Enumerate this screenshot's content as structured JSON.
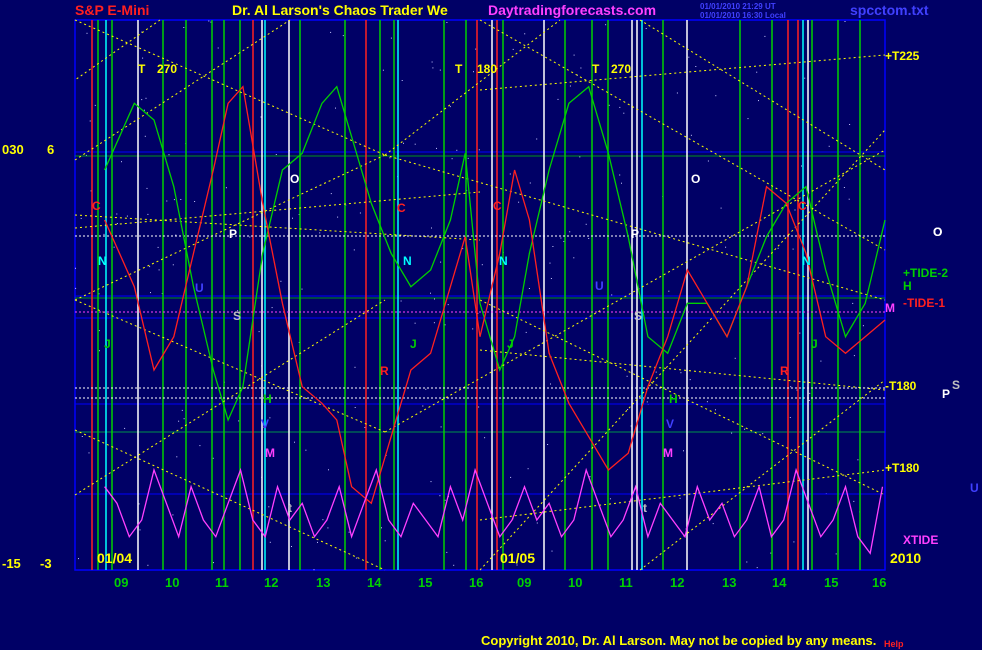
{
  "colors": {
    "background": "#000066",
    "grid_blue": "#0000ff",
    "green": "#00d000",
    "red": "#ff2020",
    "magenta": "#ff40ff",
    "yellow": "#ffff00",
    "white": "#ffffff",
    "cyan": "#00ffff",
    "copyright": "#ffff00"
  },
  "header": {
    "instrument": "S&P E-Mini",
    "title": "Dr. Al Larson's Chaos Trader We",
    "site": "Daytradingforecasts.com",
    "stamp_1": "01/01/2010 21:29 UT",
    "stamp_2": "01/01/2010 16:30 Local",
    "file": "spcctom.txt"
  },
  "footer": {
    "copyright": "Copyright 2010, Dr. Al Larson. May not be copied by any means.",
    "corner_note": "Help"
  },
  "left_scale": {
    "top_a": "030",
    "top_b": "6",
    "bottom_a": "-15",
    "bottom_b": "-3"
  },
  "chart_data": {
    "type": "line",
    "dates": [
      "01/04",
      "01/05",
      "2010"
    ],
    "x_ticks": [
      "09",
      "10",
      "11",
      "12",
      "13",
      "14",
      "15",
      "16",
      "09",
      "10",
      "11",
      "12",
      "13",
      "14",
      "15",
      "16"
    ],
    "series": [
      {
        "name": "",
        "color": "green",
        "x": [
          0,
          0.3,
          0.6,
          1.0,
          1.4,
          1.8,
          2.2,
          2.5,
          2.8,
          3.2,
          3.6,
          4.0,
          4.4,
          4.7,
          5.0,
          5.4,
          5.8,
          6.2,
          6.6,
          7.0,
          7.3,
          7.6,
          8.0,
          8.3,
          8.6,
          9.0,
          9.4,
          9.8,
          10.2,
          10.6,
          11.0,
          11.4,
          11.8,
          12.2,
          12.6,
          13.0,
          13.4,
          13.8,
          14.2,
          14.6,
          15.0,
          15.4,
          15.8
        ],
        "y": [
          9,
          11,
          13,
          12,
          8,
          2,
          -3,
          -6,
          -4,
          4,
          9,
          10,
          13,
          14,
          11,
          7,
          4,
          2,
          3,
          6,
          10,
          1,
          -3,
          -1,
          4,
          9,
          13,
          14,
          10,
          5,
          -1,
          -2,
          1,
          1,
          -1,
          2,
          5,
          7,
          8,
          3,
          -1,
          1,
          6
        ]
      },
      {
        "name": "",
        "color": "red",
        "x": [
          0,
          0.3,
          0.6,
          1.0,
          1.4,
          1.8,
          2.2,
          2.5,
          2.8,
          3.2,
          3.6,
          4.0,
          4.4,
          4.7,
          5.0,
          5.4,
          5.8,
          6.2,
          6.6,
          7.0,
          7.3,
          7.6,
          8.0,
          8.3,
          8.6,
          9.0,
          9.4,
          9.8,
          10.2,
          10.6,
          11.0,
          11.4,
          11.8,
          12.2,
          12.6,
          13.0,
          13.4,
          13.8,
          14.2,
          14.6,
          15.0,
          15.4,
          15.8
        ],
        "y": [
          6,
          4,
          2,
          -3,
          -1,
          4,
          9,
          13,
          14,
          7,
          1,
          -4,
          -5,
          -6,
          -10,
          -11,
          -7,
          -3,
          -2,
          2,
          5,
          -1,
          4,
          9,
          6,
          -2,
          -5,
          -7,
          -9,
          -8,
          -4,
          -1,
          3,
          1,
          -1,
          2,
          8,
          7,
          4,
          -1,
          -2,
          -1,
          0
        ]
      },
      {
        "name": "XTIDE",
        "color": "magenta",
        "x": [
          0,
          0.25,
          0.5,
          0.75,
          1.0,
          1.25,
          1.5,
          1.75,
          2.0,
          2.25,
          2.5,
          2.75,
          3.0,
          3.25,
          3.5,
          3.75,
          4.0,
          4.25,
          4.5,
          4.75,
          5.0,
          5.25,
          5.5,
          5.75,
          6.0,
          6.25,
          6.5,
          6.75,
          7.0,
          7.25,
          7.5,
          7.75,
          8.0,
          8.25,
          8.5,
          8.75,
          9.0,
          9.25,
          9.5,
          9.75,
          10.0,
          10.25,
          10.5,
          10.75,
          11.0,
          11.25,
          11.5,
          11.75,
          12.0,
          12.25,
          12.5,
          12.75,
          13.0,
          13.25,
          13.5,
          13.75,
          14.0,
          14.25,
          14.5,
          14.75,
          15.0,
          15.25,
          15.5,
          15.75
        ],
        "y": [
          -10,
          -11,
          -13,
          -12,
          -9,
          -11,
          -13,
          -10,
          -12,
          -13,
          -11,
          -9,
          -12,
          -13,
          -10,
          -12,
          -11,
          -13,
          -12,
          -10,
          -13,
          -11,
          -9,
          -12,
          -13,
          -11,
          -12,
          -13,
          -10,
          -12,
          -9,
          -11,
          -13,
          -12,
          -10,
          -12,
          -11,
          -13,
          -12,
          -9,
          -11,
          -13,
          -12,
          -10,
          -13,
          -11,
          -12,
          -13,
          -10,
          -12,
          -11,
          -13,
          -12,
          -10,
          -13,
          -12,
          -9,
          -11,
          -13,
          -12,
          -10,
          -13,
          -14,
          -10
        ]
      }
    ],
    "ylim": [
      -15,
      18
    ],
    "xlim": [
      -0.6,
      15.8
    ],
    "right_labels": [
      {
        "text": "+T225",
        "color": "yellow"
      },
      {
        "text": "+TIDE-2",
        "color": "green"
      },
      {
        "text": "H",
        "color": "green"
      },
      {
        "text": "-TIDE-1",
        "color": "red"
      },
      {
        "text": "M",
        "color": "magenta"
      },
      {
        "text": "-T180",
        "color": "yellow"
      },
      {
        "text": "+T180",
        "color": "yellow"
      },
      {
        "text": "XTIDE",
        "color": "magenta"
      },
      {
        "text": "O",
        "color": "white"
      },
      {
        "text": "P",
        "color": "white"
      },
      {
        "text": "S",
        "color": "silver"
      },
      {
        "text": "U",
        "color": "blue"
      }
    ],
    "annotations": [
      {
        "text": "T",
        "color": "yellow"
      },
      {
        "text": "270",
        "color": "yellow"
      },
      {
        "text": "T",
        "color": "yellow"
      },
      {
        "text": "180",
        "color": "yellow"
      },
      {
        "text": "T",
        "color": "yellow"
      },
      {
        "text": "270",
        "color": "yellow"
      },
      {
        "text": "C",
        "color": "red"
      },
      {
        "text": "N",
        "color": "cyan"
      },
      {
        "text": "J",
        "color": "green"
      },
      {
        "text": "P",
        "color": "white"
      },
      {
        "text": "U",
        "color": "blue"
      },
      {
        "text": "S",
        "color": "silver"
      },
      {
        "text": "O",
        "color": "white"
      },
      {
        "text": "H",
        "color": "green"
      },
      {
        "text": "V",
        "color": "blue"
      },
      {
        "text": "M",
        "color": "magenta"
      },
      {
        "text": "C",
        "color": "red"
      },
      {
        "text": "N",
        "color": "cyan"
      },
      {
        "text": "J",
        "color": "green"
      },
      {
        "text": "R",
        "color": "red"
      },
      {
        "text": "C",
        "color": "red"
      },
      {
        "text": "N",
        "color": "cyan"
      },
      {
        "text": "J",
        "color": "green"
      },
      {
        "text": "P",
        "color": "white"
      },
      {
        "text": "U",
        "color": "blue"
      },
      {
        "text": "S",
        "color": "silver"
      },
      {
        "text": "O",
        "color": "white"
      },
      {
        "text": "H",
        "color": "green"
      },
      {
        "text": "V",
        "color": "blue"
      },
      {
        "text": "M",
        "color": "magenta"
      },
      {
        "text": "C",
        "color": "red"
      },
      {
        "text": "N",
        "color": "cyan"
      },
      {
        "text": "J",
        "color": "green"
      },
      {
        "text": "R",
        "color": "red"
      },
      {
        "text": "O",
        "color": "white"
      },
      {
        "text": "t",
        "color": "silver"
      },
      {
        "text": "t",
        "color": "silver"
      }
    ]
  }
}
